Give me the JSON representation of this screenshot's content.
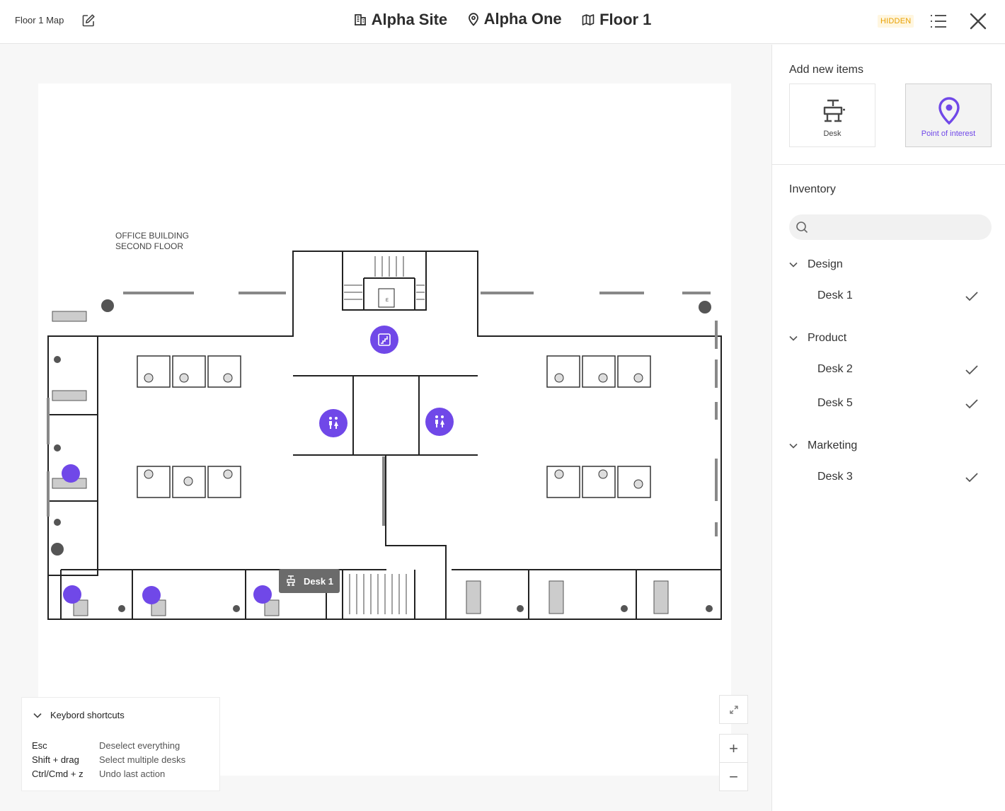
{
  "header": {
    "map_title": "Floor 1 Map",
    "edit_icon": "edit-icon",
    "breadcrumbs": [
      {
        "label": "Alpha Site",
        "icon": "building-icon"
      },
      {
        "label": "Alpha One",
        "icon": "location-pin-icon"
      },
      {
        "label": "Floor 1",
        "icon": "map-icon"
      }
    ],
    "status_badge": "HIDDEN",
    "list_icon": "list-icon",
    "close_icon": "close-icon"
  },
  "map": {
    "plan_title_line1": "OFFICE BUILDING",
    "plan_title_line2": "SECOND FLOOR",
    "door_label": "E",
    "hover_tooltip": "Desk 1",
    "points_of_interest": [
      "stairs-icon",
      "restroom-icon",
      "restroom-icon"
    ]
  },
  "shortcuts": {
    "title": "Keybord shortcuts",
    "items": [
      {
        "key": "Esc",
        "desc": "Deselect everything"
      },
      {
        "key": "Shift + drag",
        "desc": "Select multiple desks"
      },
      {
        "key": "Ctrl/Cmd + z",
        "desc": "Undo last action"
      }
    ]
  },
  "controls": {
    "fit": "fit-screen-icon",
    "zoom_in": "+",
    "zoom_out": "−"
  },
  "panel": {
    "add_title": "Add new items",
    "add_items": [
      {
        "label": "Desk",
        "icon": "desk-icon",
        "selected": false
      },
      {
        "label": "Point of interest",
        "icon": "location-pin-icon",
        "selected": true
      }
    ],
    "inventory_title": "Inventory",
    "search_placeholder": "",
    "groups": [
      {
        "name": "Design",
        "items": [
          "Desk 1"
        ]
      },
      {
        "name": "Product",
        "items": [
          "Desk 2",
          "Desk 5"
        ]
      },
      {
        "name": "Marketing",
        "items": [
          "Desk 3"
        ]
      }
    ]
  },
  "colors": {
    "accent": "#7048e8",
    "badge": "#e8a000"
  }
}
